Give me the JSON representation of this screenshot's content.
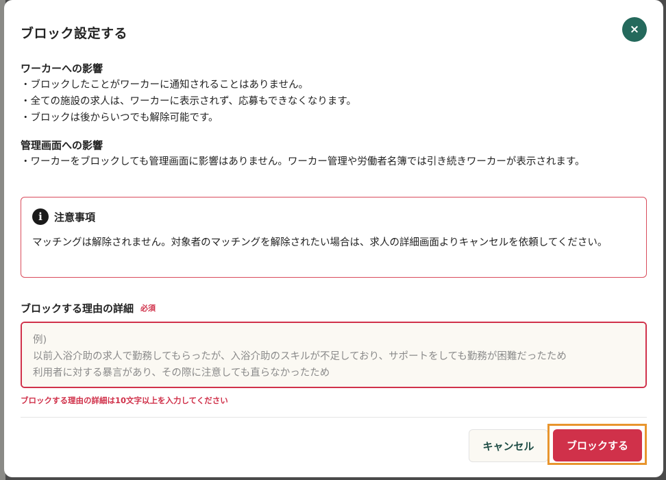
{
  "modal": {
    "title": "ブロック設定する",
    "close_glyph": "×"
  },
  "worker_impact": {
    "heading": "ワーカーへの影響",
    "lines": [
      "・ブロックしたことがワーカーに通知されることはありません。",
      "・全ての施設の求人は、ワーカーに表示されず、応募もできなくなります。",
      "・ブロックは後からいつでも解除可能です。"
    ]
  },
  "admin_impact": {
    "heading": "管理画面への影響",
    "text": "・ワーカーをブロックしても管理画面に影響はありません。ワーカー管理や労働者名簿では引き続きワーカーが表示されます。"
  },
  "notice": {
    "icon": "info-icon",
    "title": "注意事項",
    "body": "マッチングは解除されません。対象者のマッチングを解除されたい場合は、求人の詳細画面よりキャンセルを依頼してください。"
  },
  "reason_field": {
    "label": "ブロックする理由の詳細",
    "required_badge": "必須",
    "value": "",
    "placeholder": "例)\n以前入浴介助の求人で勤務してもらったが、入浴介助のスキルが不足しており、サポートをしても勤務が困難だったため\n利用者に対する暴言があり、その際に注意しても直らなかったため",
    "error": "ブロックする理由の詳細は10文字以上を入力してください"
  },
  "footer": {
    "cancel_label": "キャンセル",
    "submit_label": "ブロックする"
  },
  "colors": {
    "accent_green": "#24695c",
    "danger_red": "#d0314a",
    "highlight_orange": "#e8952d"
  }
}
